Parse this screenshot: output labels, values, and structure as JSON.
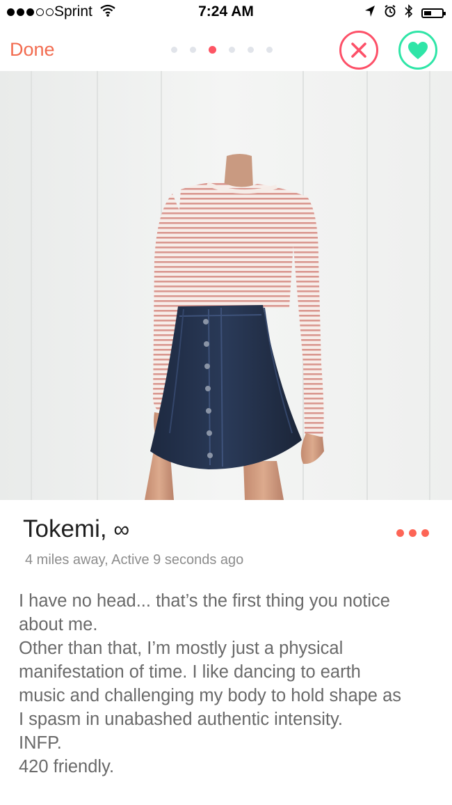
{
  "status_bar": {
    "carrier": "Sprint",
    "time": "7:24 AM",
    "signal_bars_filled": 3,
    "signal_bars_total": 5,
    "icons": [
      "wifi-icon",
      "location-arrow-icon",
      "alarm-icon",
      "bluetooth-icon",
      "battery-icon"
    ]
  },
  "nav": {
    "done_label": "Done",
    "photo_page_count": 6,
    "photo_active_index": 2,
    "nope_icon": "close-icon",
    "like_icon": "heart-icon"
  },
  "profile": {
    "name": "Tokemi,",
    "age": "∞",
    "meta": "4 miles away, Active 9 seconds ago",
    "bio_lines": [
      "I have no head... that’s the first thing you notice",
      "about me.",
      "Other than that, I’m mostly just a physical",
      "manifestation of time. I like dancing to earth",
      "music and challenging my body to hold shape as",
      "I spasm in unabashed authentic intensity.",
      "INFP.",
      "420 friendly."
    ]
  },
  "colors": {
    "accent": "#f26b4f",
    "nope": "#fd5068",
    "like": "#2fe5a7",
    "active_dot": "#fd5564",
    "meta_text": "#8c8c8c",
    "bio_text": "#696969"
  }
}
